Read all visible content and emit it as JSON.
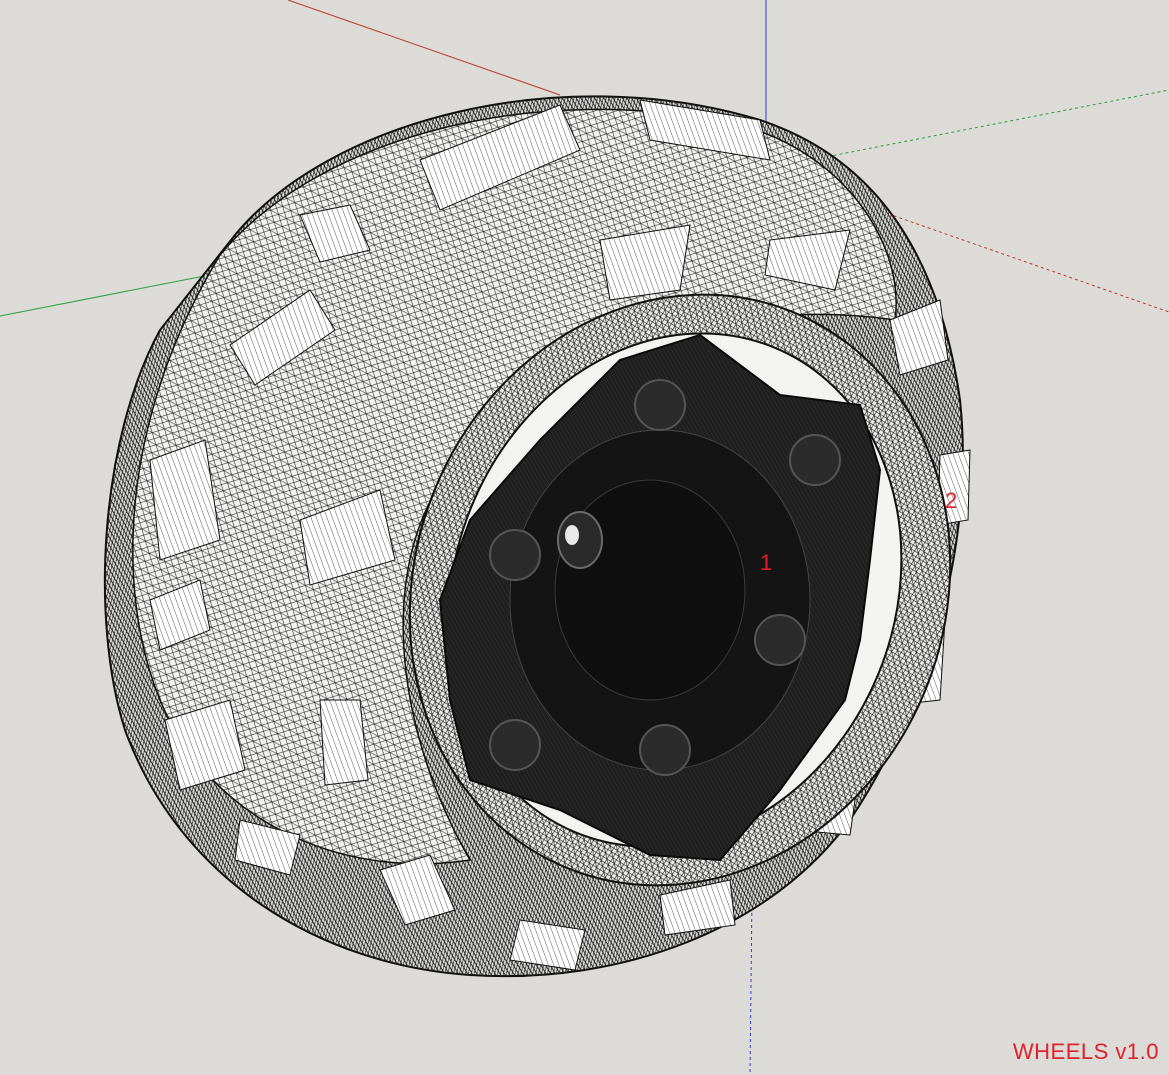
{
  "viewport": {
    "background": "#dcdbd7"
  },
  "axes": {
    "red_axis_color": "#c0392b",
    "green_axis_color": "#2e9e3e",
    "blue_axis_color": "#2b3fd6"
  },
  "model": {
    "wire_color": "#1a1a1a",
    "tread_block_color": "#ffffff",
    "hub_color": "#1c1c1c",
    "labels": [
      {
        "text": "1",
        "color": "#e0202a"
      },
      {
        "text": "2",
        "color": "#e0202a"
      }
    ]
  },
  "overlay": {
    "title": "WHEELS v1.0",
    "title_color": "#e0202a"
  }
}
